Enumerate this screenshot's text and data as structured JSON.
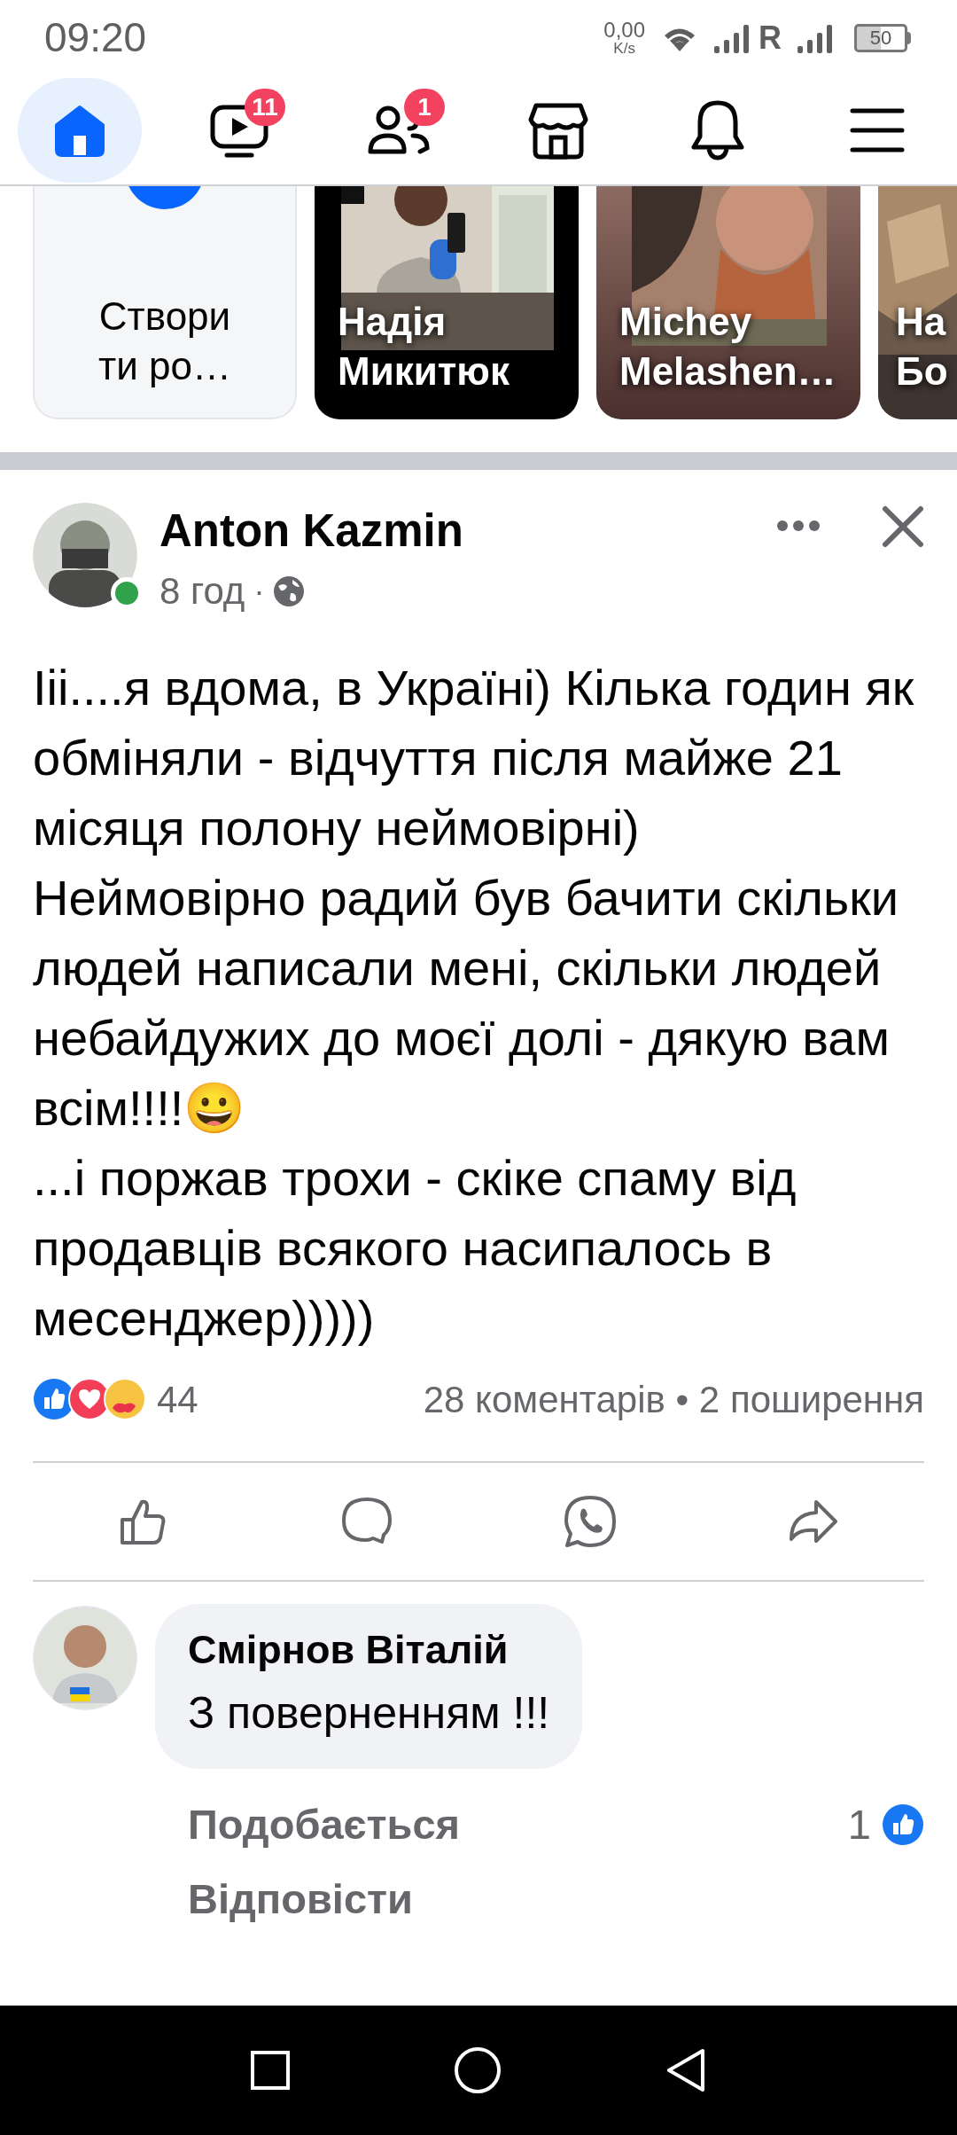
{
  "status_bar": {
    "time": "09:20",
    "speed": "0,00",
    "speed_unit": "K/s",
    "network_letter": "R",
    "battery": "50"
  },
  "nav": {
    "tabs": [
      {
        "selected": true
      },
      {
        "selected": false,
        "badge": "11"
      },
      {
        "selected": false,
        "badge": "1"
      },
      {
        "selected": false
      },
      {
        "selected": false
      },
      {
        "selected": false
      }
    ]
  },
  "stories": [
    {
      "kind": "create",
      "label": "Створи\nти ро…"
    },
    {
      "kind": "story",
      "name": "Надія Микитюк"
    },
    {
      "kind": "story",
      "name": "Michey Melashen…"
    },
    {
      "kind": "story",
      "name": "На Бо"
    }
  ],
  "post": {
    "author": "Anton Kazmin",
    "online": true,
    "time": "8 год",
    "separator": "·",
    "text": "Ііі....я вдома, в Україні) Кілька годин як обміняли - відчуття після майже 21 місяця полону неймовірні) Неймовірно радий був бачити скільки людей написали мені, скільки людей небайдужих до моєї долі - дякую вам всім!!!!😀\n...і поржав трохи - скіке спаму від продавців всякого насипалось в месенджер)))))",
    "reactions_count": "44",
    "stats": "28 коментарів • 2 поширення"
  },
  "comments": [
    {
      "author": "Смірнов Віталій",
      "text": "З поверненням !!!",
      "like_label": "Подобається",
      "reply_label": "Відповісти",
      "likes": "1"
    }
  ]
}
